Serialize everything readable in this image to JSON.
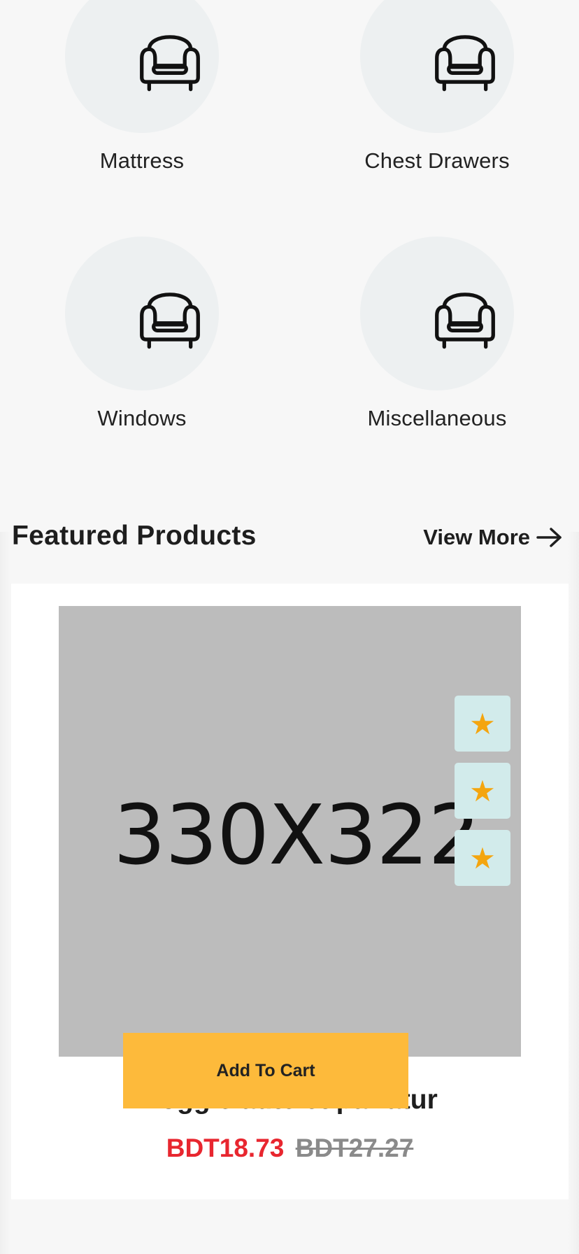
{
  "categories": [
    {
      "label": "Mattress",
      "icon": "armchair-icon"
    },
    {
      "label": "Chest Drawers",
      "icon": "armchair-icon"
    },
    {
      "label": "Windows",
      "icon": "armchair-icon"
    },
    {
      "label": "Miscellaneous",
      "icon": "armchair-icon"
    }
  ],
  "featured": {
    "title": "Featured Products",
    "view_more_label": "View More",
    "view_more_icon": "arrow-right-icon"
  },
  "product": {
    "image_placeholder_text": "330X322",
    "name": "Xoggle aute et pariatur",
    "add_to_cart_label": "Add To Cart",
    "price_current": "BDT18.73",
    "price_original": "BDT27.27",
    "action_icons": [
      "star-icon",
      "star-icon",
      "star-icon"
    ],
    "action_glyph": "★"
  },
  "colors": {
    "background": "#f7f7f7",
    "category_circle": "#edf0f1",
    "image_placeholder": "#bcbcbc",
    "action_button_bg": "#d2ebeb",
    "star": "#f4a50f",
    "add_to_cart_bg": "#fdba3b",
    "price_current": "#e8262f",
    "price_original": "#8a8a8a"
  }
}
